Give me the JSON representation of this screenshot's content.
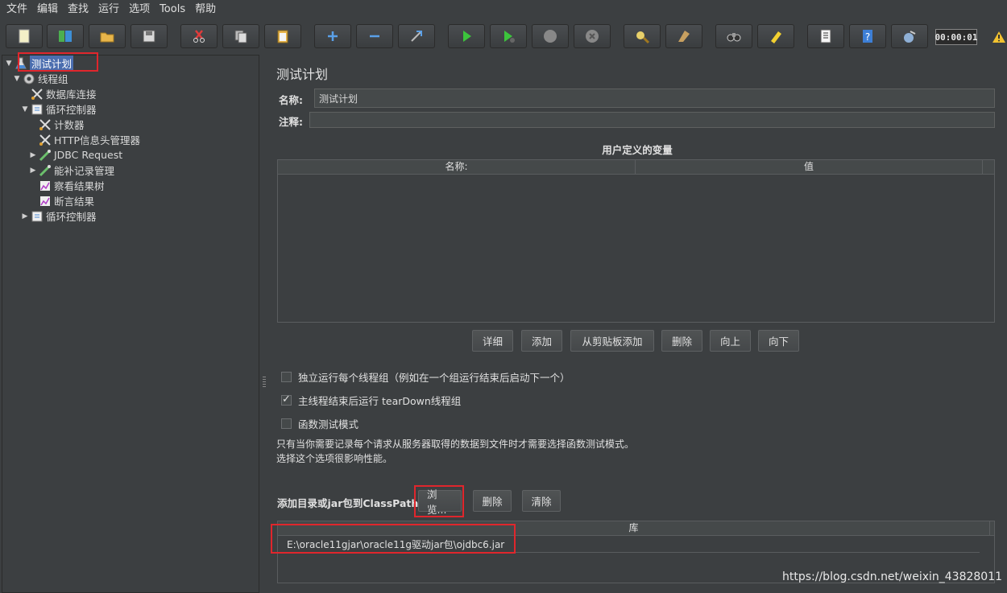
{
  "menu": [
    "文件",
    "编辑",
    "查找",
    "运行",
    "选项",
    "Tools",
    "帮助"
  ],
  "toolbar": {
    "icons": [
      "new-icon",
      "templates-icon",
      "open-icon",
      "save-icon",
      "cut-icon",
      "copy-icon",
      "paste-icon",
      "expand-icon",
      "collapse-icon",
      "toggle-icon",
      "start-icon",
      "start-no-pause-icon",
      "stop-icon",
      "shutdown-icon",
      "clear-icon",
      "clear-all-icon",
      "search-icon",
      "reset-search-icon",
      "function-helper-icon",
      "help-icon",
      "remote-icon"
    ],
    "timer": "00:00:01"
  },
  "tree": [
    {
      "label": "测试计划",
      "indent": 0,
      "toggle": "▼",
      "icon": "test-plan-icon",
      "selected": true
    },
    {
      "label": "线程组",
      "indent": 1,
      "toggle": "▼",
      "icon": "thread-group-icon"
    },
    {
      "label": "数据库连接",
      "indent": 2,
      "toggle": "",
      "icon": "config-element-icon"
    },
    {
      "label": "循环控制器",
      "indent": 2,
      "toggle": "▼",
      "icon": "loop-controller-icon"
    },
    {
      "label": "计数器",
      "indent": 3,
      "toggle": "",
      "icon": "config-element-icon"
    },
    {
      "label": "HTTP信息头管理器",
      "indent": 3,
      "toggle": "",
      "icon": "config-element-icon"
    },
    {
      "label": "JDBC Request",
      "indent": 3,
      "toggle": "▶",
      "icon": "sampler-icon"
    },
    {
      "label": "能补记录管理",
      "indent": 3,
      "toggle": "▶",
      "icon": "sampler-icon"
    },
    {
      "label": "察看结果树",
      "indent": 3,
      "toggle": "",
      "icon": "listener-icon"
    },
    {
      "label": "断言结果",
      "indent": 3,
      "toggle": "",
      "icon": "listener-icon"
    },
    {
      "label": "循环控制器",
      "indent": 2,
      "toggle": "▶",
      "icon": "loop-controller-icon"
    }
  ],
  "panel": {
    "title": "测试计划",
    "name_label": "名称:",
    "name_value": "测试计划",
    "comment_label": "注释:",
    "comment_value": "",
    "vars_title": "用户定义的变量",
    "vars_col_name": "名称:",
    "vars_col_value": "值",
    "buttons": {
      "detail": "详细",
      "add": "添加",
      "add_clipboard": "从剪贴板添加",
      "delete": "删除",
      "up": "向上",
      "down": "向下"
    },
    "checkboxes": [
      {
        "label": "独立运行每个线程组（例如在一个组运行结束后启动下一个）",
        "checked": false
      },
      {
        "label": "主线程结束后运行 tearDown线程组",
        "checked": true
      },
      {
        "label": "函数测试模式",
        "checked": false
      }
    ],
    "note_line1": "只有当你需要记录每个请求从服务器取得的数据到文件时才需要选择函数测试模式。",
    "note_line2": "选择这个选项很影响性能。",
    "classpath_label": "添加目录或jar包到ClassPath",
    "classpath_buttons": {
      "browse": "浏览...",
      "delete": "删除",
      "clear": "清除"
    },
    "lib_header": "库",
    "lib_rows": [
      "E:\\oracle11gjar\\oracle11g驱动jar包\\ojdbc6.jar"
    ]
  },
  "watermark": "https://blog.csdn.net/weixin_43828011",
  "colors": {
    "background": "#3c3f41",
    "selection": "#4b6eaf",
    "highlight": "#e0262c"
  }
}
